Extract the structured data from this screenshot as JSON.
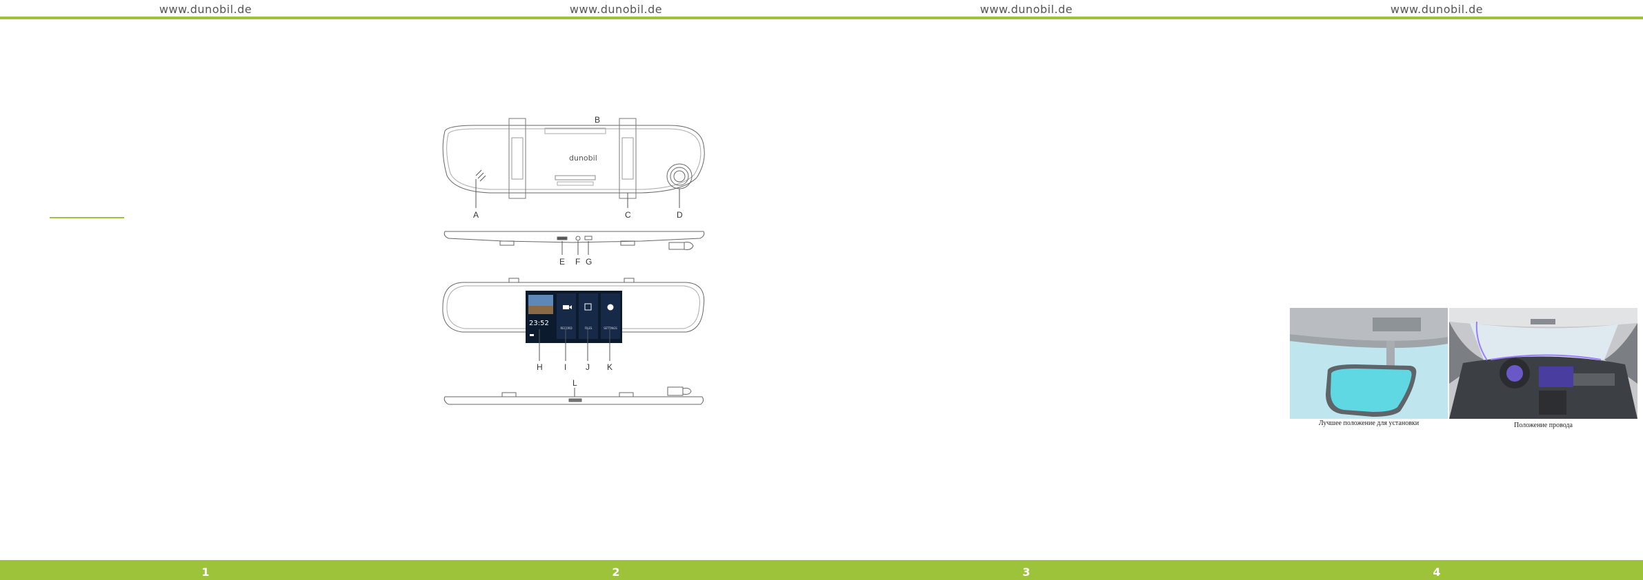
{
  "header": {
    "urls": [
      "www.dunobil.de",
      "www.dunobil.de",
      "www.dunobil.de",
      "www.dunobil.de"
    ]
  },
  "footer": {
    "page_numbers": [
      "1",
      "2",
      "3",
      "4"
    ]
  },
  "diagram": {
    "brand": "dunobil",
    "labels": {
      "A": "A",
      "B": "B",
      "C": "C",
      "D": "D",
      "E": "E",
      "F": "F",
      "G": "G",
      "H": "H",
      "I": "I",
      "J": "J",
      "K": "K",
      "L": "L"
    },
    "screen": {
      "time": "23:52",
      "menu": [
        "RECORD",
        "FILES",
        "SETTINGS"
      ]
    }
  },
  "photos": {
    "mirror_caption": "Лучшее положение для установки",
    "cable_caption": "Положение провода"
  },
  "colors": {
    "accent": "#9dc33b",
    "screen_bg": "#0c1a2e"
  }
}
